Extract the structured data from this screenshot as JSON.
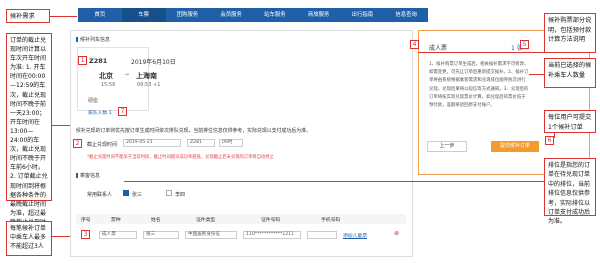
{
  "nav": [
    "首页",
    "车票",
    "团购服务",
    "会员服务",
    "站车服务",
    "商旅服务",
    "出行指南",
    "信息查询"
  ],
  "ticket": {
    "section": "候补列车信息",
    "train": "Z281",
    "date": "2019年6月10日",
    "from": "北京",
    "to": "上海南",
    "dep": "15:56",
    "arr": "09:53 +1",
    "seat": "硬座",
    "rank_label": "排队人数 1",
    "rank_num": "1",
    "rank_tag": "7"
  },
  "notice": "候补兑现的订单将优先按订单生成时间依次排队兑现，当前排位信息仅供参考，实际兑现以支付成功后为准。",
  "deadline": {
    "label": "截止兑现时间",
    "date": "2019-05-21",
    "train_sel": "Z281",
    "time_sel": "09时",
    "note": "*截止兑现时间不能早于当前时间，截止时间越早成功率越低，兑现截止后未兑现的订单将自动终止",
    "tag": "2"
  },
  "passenger": {
    "title": "乘客信息",
    "common": "常用联系人",
    "p1": "张三",
    "p2": "李四"
  },
  "table": {
    "headers": [
      "序号",
      "票种",
      "姓名",
      "证件类型",
      "证件号码",
      "手机号码"
    ],
    "row": {
      "idx": "1",
      "type": "成人票",
      "name": "张三",
      "id_type": "中国居民身份证",
      "id_no": "110************1211",
      "phone": ""
    },
    "add": "添加儿童票",
    "tag": "3"
  },
  "right": {
    "ticket_type": "成人票",
    "amount": "1 张",
    "tip": "1、候补购票订单生成后，相关候补需求不可修改，如需变更，可先让订单后重新提交候补。2、候补订单将由系统根据乘客需求和兑现排位顺序依次进行兑现，兑现结果将以短信等方式通知。3、兑现后的订单将按实际兑现票价计算，如兑现后的票价低于预付款，差额将退回原支付账户。",
    "prev": "上一步",
    "submit": "提交候补订单",
    "tag4": "4",
    "tag5": "5",
    "tag6": "6"
  },
  "anno": {
    "top": "候补需求",
    "tag1": "1",
    "left1": "订单的截止兑现时间计算以车次开车时间为准: 1. 开车时间在00:00—12:59的车次，截止兑现时间不晚于前一天23:00；开车时间在13:00—24:00的车次，截止兑现时间不晚于开车前6小时。2. 订单截止兑现时间到将根据各种条件的最晚截止时间为准，超过最晚截止兑现时间的需求自动结束兑现",
    "left2": "每笔候补订单中乘车人最多不能超过3人",
    "r1": "候补购票部分说明，包括预付款计算方法说明",
    "r2": "当前已选择的候补乘车人数量",
    "r3": "每位用户可提交1个候补订单",
    "r4": "排位是指您的订单在待兑现订单中的排位，当前排位信息仅供参考，实际排位以订单支付成功后为准。"
  }
}
